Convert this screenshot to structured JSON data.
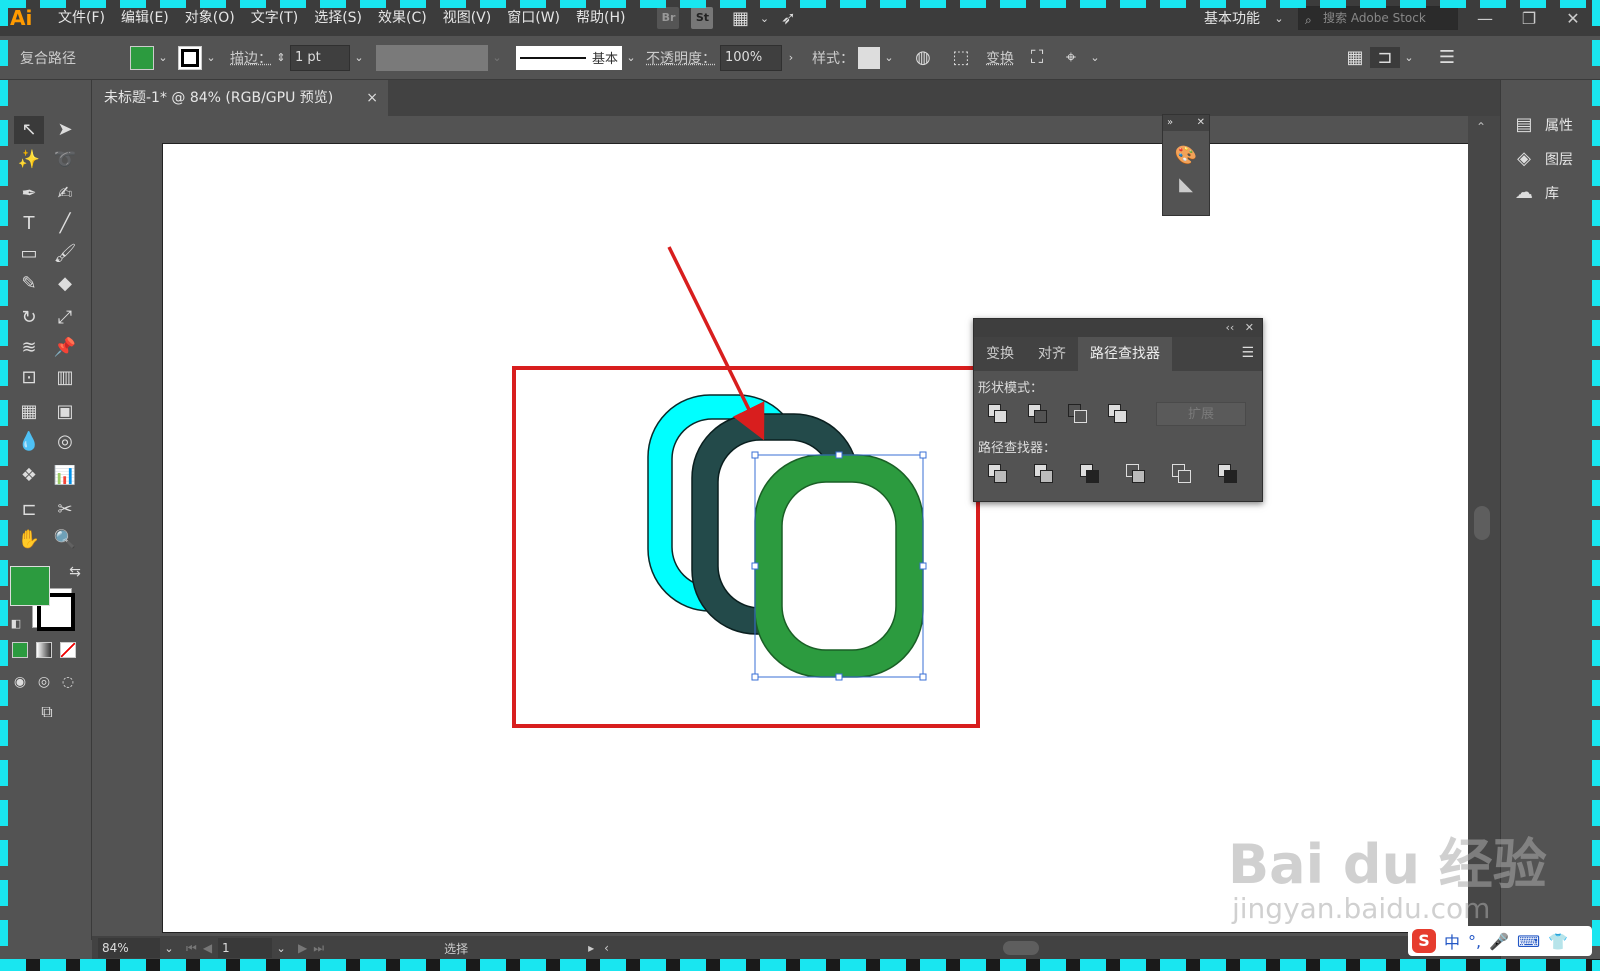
{
  "app": {
    "logo": "Ai"
  },
  "menu": {
    "items": [
      "文件(F)",
      "编辑(E)",
      "对象(O)",
      "文字(T)",
      "选择(S)",
      "效果(C)",
      "视图(V)",
      "窗口(W)",
      "帮助(H)"
    ],
    "br": "Br",
    "st": "St",
    "workspace": "基本功能",
    "search_placeholder": "搜索 Adobe Stock"
  },
  "control": {
    "selection_type": "复合路径",
    "stroke_label": "描边：",
    "stroke_value": "1 pt",
    "stroke_style": "基本",
    "opacity_label": "不透明度：",
    "opacity_value": "100%",
    "style_label": "样式：",
    "transform_label": "变换",
    "fill_color": "#2c9b3f"
  },
  "document": {
    "tab_title": "未标题-1* @ 84% (RGB/GPU 预览)",
    "close": "×"
  },
  "status": {
    "zoom": "84%",
    "artboard": "1",
    "tool": "选择"
  },
  "right_dock": {
    "items": [
      "属性",
      "图层",
      "库"
    ]
  },
  "pathfinder": {
    "tabs": [
      "变换",
      "对齐",
      "路径查找器"
    ],
    "active_tab": 2,
    "shape_modes_label": "形状模式：",
    "pathfinders_label": "路径查找器：",
    "expand": "扩展"
  },
  "artwork": {
    "ring_colors": [
      "#00ffff",
      "#234a4a",
      "#2c9b3f"
    ],
    "annotation_color": "#d81e1e"
  },
  "watermark": {
    "main": "Bai du 经验",
    "sub": "jingyan.baidu.com"
  },
  "ime": {
    "lang": "中"
  }
}
